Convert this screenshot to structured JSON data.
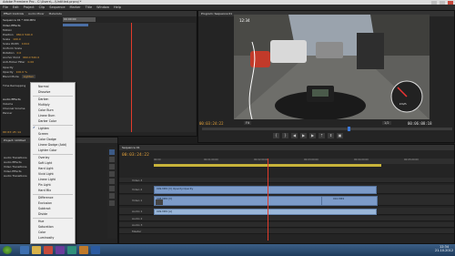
{
  "window": {
    "title": "Adobe Premiere Pro - C:\\Users\\...\\Untitled.prproj *"
  },
  "menu_bar": [
    "File",
    "Edit",
    "Project",
    "Clip",
    "Sequence",
    "Marker",
    "Title",
    "Window",
    "Help"
  ],
  "effect_controls": {
    "tabs": [
      "Effect Controls",
      "Audio Mixer",
      "Metadata"
    ],
    "clip_label": "Sequence 01 * 009.MP4",
    "timecode_chip": "00:00:00",
    "section": "Video Effects",
    "rows": [
      {
        "label": "Motion",
        "value": ""
      },
      {
        "label": "Position",
        "value": "960.0  540.0"
      },
      {
        "label": "Scale",
        "value": "100.0"
      },
      {
        "label": "Scale Width",
        "value": "100.0"
      },
      {
        "label": "Uniform Scale",
        "value": ""
      },
      {
        "label": "Rotation",
        "value": "0.0"
      },
      {
        "label": "Anchor Point",
        "value": "960.0  540.0"
      },
      {
        "label": "Anti-flicker Filter",
        "value": "0.00"
      },
      {
        "label": "Opacity",
        "value": ""
      },
      {
        "label": "Opacity",
        "value": "100.0 %"
      },
      {
        "label": "Blend Mode",
        "value": "Lighten"
      },
      {
        "label": "Time Remapping",
        "value": ""
      },
      {
        "label": "Audio Effects",
        "value": ""
      },
      {
        "label": "Volume",
        "value": ""
      },
      {
        "label": "Channel Volume",
        "value": ""
      },
      {
        "label": "Panner",
        "value": ""
      }
    ],
    "footer_tc": "00:03:25:14"
  },
  "blend_menu": {
    "selected": "Lighten",
    "items": [
      "Normal",
      "Dissolve",
      "Darken",
      "Multiply",
      "Color Burn",
      "Linear Burn",
      "Darker Color",
      "Lighten",
      "Screen",
      "Color Dodge",
      "Linear Dodge (Add)",
      "Lighter Color",
      "Overlay",
      "Soft Light",
      "Hard Light",
      "Vivid Light",
      "Linear Light",
      "Pin Light",
      "Hard Mix",
      "Difference",
      "Exclusion",
      "Subtract",
      "Divide",
      "Hue",
      "Saturation",
      "Color",
      "Luminosity"
    ]
  },
  "program_monitor": {
    "tab": "Program: Sequence 01",
    "tc_left": "00:03:24:22",
    "fit": "Fit",
    "res": "1/2",
    "tc_right": "00:06:08:18",
    "hud_clock": "12:34",
    "hud_gauge_label": "km/h"
  },
  "project_panel": {
    "tab": "Project: Untitled",
    "items": [
      "Audio Transitions",
      "Audio Effects",
      "Video Transitions",
      "Video Effects",
      "Audio Transitions"
    ]
  },
  "timeline": {
    "tab": "Sequence 01",
    "tc": "00:03:24:22",
    "ruler": [
      "00:00",
      "00:01:00:00",
      "00:02:00:00",
      "00:03:00:00",
      "00:04:00:00",
      "00:05:00:00"
    ],
    "tracks": [
      "Video 3",
      "Video 2",
      "Video 1",
      "Audio 1",
      "Audio 2",
      "Audio 3",
      "Master"
    ],
    "clips": {
      "v2": "009.MP4 [V]  Opacity:Opacity",
      "v1": "008.MP4 [V]",
      "a1": "009.MP4 [A]",
      "v1b": "010.MP4"
    }
  },
  "taskbar": {
    "time": "12:34",
    "date": "21.10.2012"
  }
}
